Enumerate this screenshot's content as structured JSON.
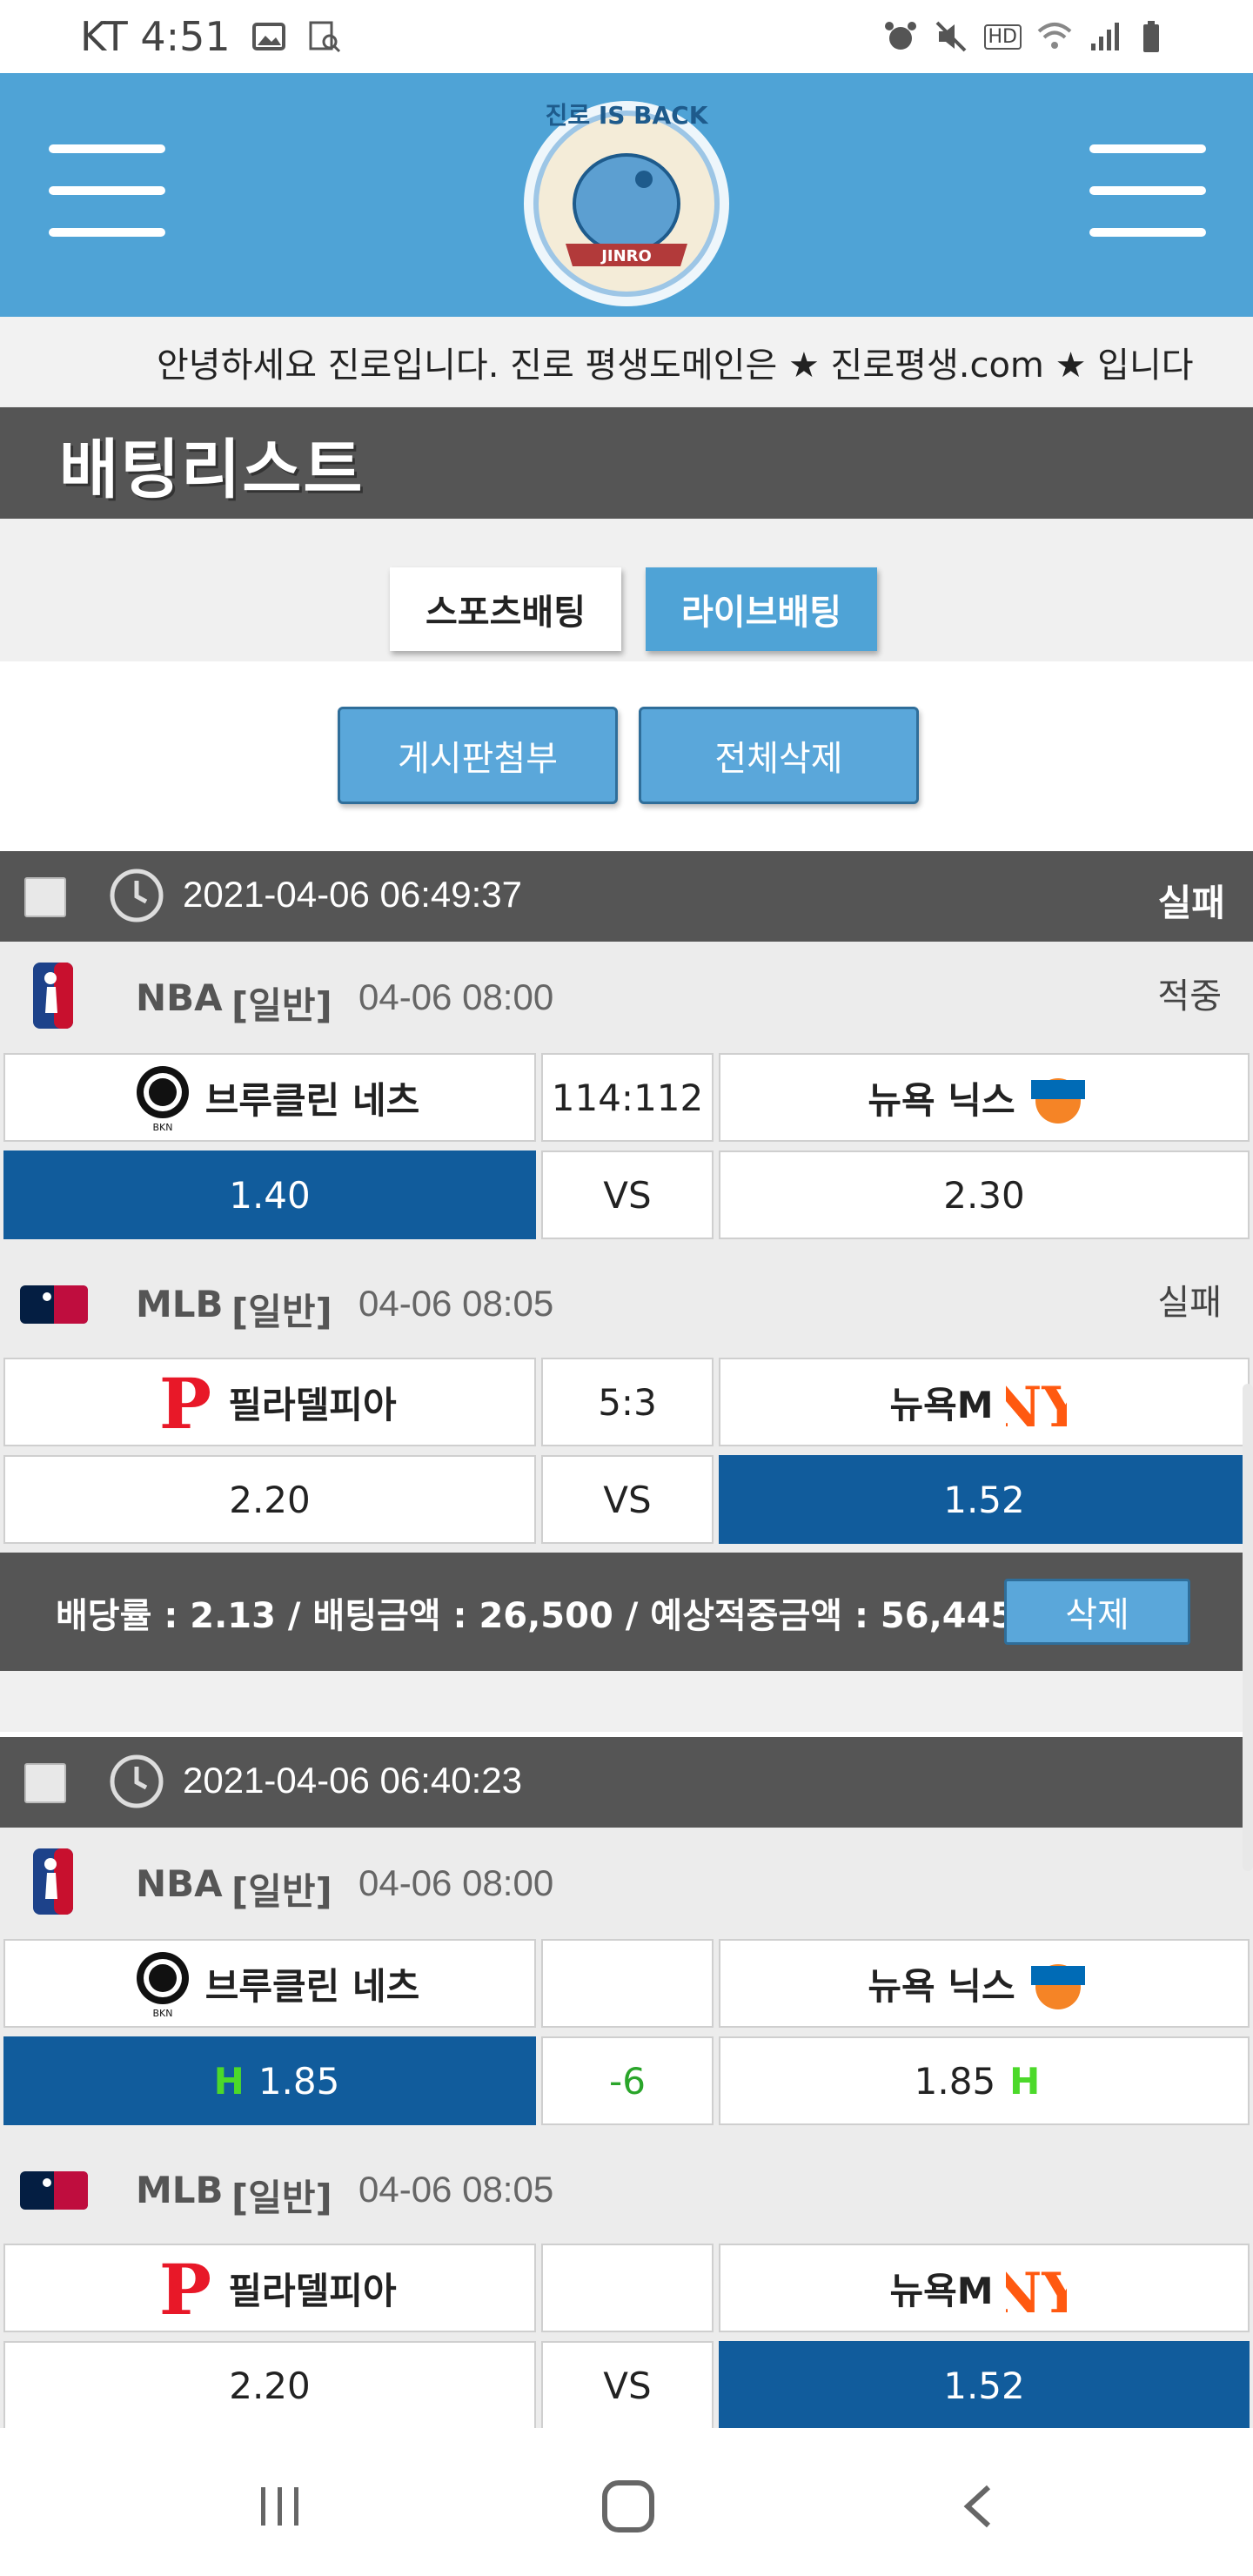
{
  "status_bar": {
    "carrier_time": "KT 4:51",
    "icons_left": [
      "image-icon",
      "chart-search-icon"
    ],
    "icons_right": [
      "alarm-icon",
      "mute-icon",
      "hd-icon",
      "wifi-icon",
      "signal-icon",
      "battery-icon"
    ],
    "hd_label": "HD"
  },
  "header": {
    "logo_text_top": "진로 IS BACK",
    "logo_text_banner": "JINRO"
  },
  "marquee": {
    "text": "안녕하세요 진로입니다. 진로 평생도메인은 ★ 진로평생.com ★ 입니다"
  },
  "page_title": "배팅리스트",
  "tabs": [
    {
      "label": "스포츠배팅"
    },
    {
      "label": "라이브배팅"
    }
  ],
  "actions": {
    "attach_label": "게시판첨부",
    "delete_all_label": "전체삭제"
  },
  "groups": [
    {
      "datetime": "2021-04-06 06:49:37",
      "result": "실패",
      "matches": [
        {
          "league": "NBA",
          "type": "[일반]",
          "time": "04-06 08:00",
          "result": "적중",
          "home": "브루클린 네츠",
          "away": "뉴욕 닉스",
          "score": "114:112",
          "home_odds": "1.40",
          "mid": "VS",
          "away_odds": "2.30"
        },
        {
          "league": "MLB",
          "type": "[일반]",
          "time": "04-06 08:05",
          "result": "실패",
          "home": "필라델피아",
          "away": "뉴욕M",
          "score": "5:3",
          "home_odds": "2.20",
          "mid": "VS",
          "away_odds": "1.52"
        }
      ],
      "summary": "배당률 : 2.13 / 배팅금액 : 26,500 / 예상적중금액 : 56,445",
      "delete_label": "삭제"
    },
    {
      "datetime": "2021-04-06 06:40:23",
      "result": "",
      "matches": [
        {
          "league": "NBA",
          "type": "[일반]",
          "time": "04-06 08:00",
          "result": "",
          "home": "브루클린 네츠",
          "away": "뉴욕 닉스",
          "score": "",
          "home_odds": "1.85",
          "mid": "-6",
          "away_odds": "1.85",
          "handicap_mark": "H"
        },
        {
          "league": "MLB",
          "type": "[일반]",
          "time": "04-06 08:05",
          "result": "",
          "home": "필라델피아",
          "away": "뉴욕M",
          "score": "",
          "home_odds": "2.20",
          "mid": "VS",
          "away_odds": "1.52"
        }
      ]
    }
  ],
  "colors": {
    "header_blue": "#4fa3d6",
    "dark_gray": "#555555",
    "selected_blue": "#115c9c",
    "handicap_green": "#4cd92a"
  },
  "nav_bar": {
    "icons": [
      "recent-apps-icon",
      "home-icon",
      "back-icon"
    ]
  }
}
